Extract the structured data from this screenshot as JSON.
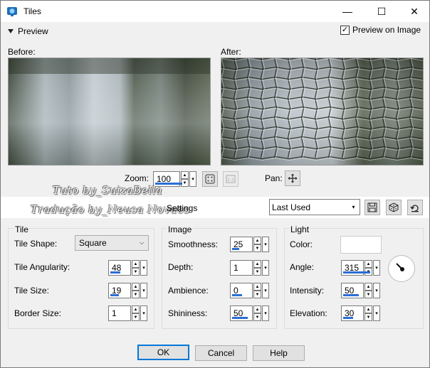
{
  "window": {
    "title": "Tiles",
    "minimize": "—",
    "maximize": "☐",
    "close": "✕"
  },
  "preview": {
    "toggle_label": "Preview",
    "preview_on_image_label": "Preview on Image",
    "preview_on_image_checked": true,
    "before_label": "Before:",
    "after_label": "After:"
  },
  "zoom": {
    "label": "Zoom:",
    "value": "100",
    "pan_label": "Pan:"
  },
  "settings": {
    "label": "Settings",
    "preset": "Last Used"
  },
  "watermark": {
    "line1": "Tuto by_SuizaBella",
    "line2": "Tradução by_Neusa Novaes"
  },
  "tile": {
    "title": "Tile",
    "shape_label": "Tile Shape:",
    "shape_value": "Square",
    "angularity_label": "Tile Angularity:",
    "angularity_value": "48",
    "size_label": "Tile Size:",
    "size_value": "19",
    "border_label": "Border Size:",
    "border_value": "1"
  },
  "image": {
    "title": "Image",
    "smoothness_label": "Smoothness:",
    "smoothness_value": "25",
    "depth_label": "Depth:",
    "depth_value": "1",
    "ambience_label": "Ambience:",
    "ambience_value": "0",
    "shininess_label": "Shininess:",
    "shininess_value": "50"
  },
  "light": {
    "title": "Light",
    "color_label": "Color:",
    "color_value": "#ffffff",
    "angle_label": "Angle:",
    "angle_value": "315",
    "intensity_label": "Intensity:",
    "intensity_value": "50",
    "elevation_label": "Elevation:",
    "elevation_value": "30"
  },
  "buttons": {
    "ok": "OK",
    "cancel": "Cancel",
    "help": "Help"
  },
  "colors": {
    "accent": "#2a6ed4",
    "default_button": "#0078d7"
  }
}
